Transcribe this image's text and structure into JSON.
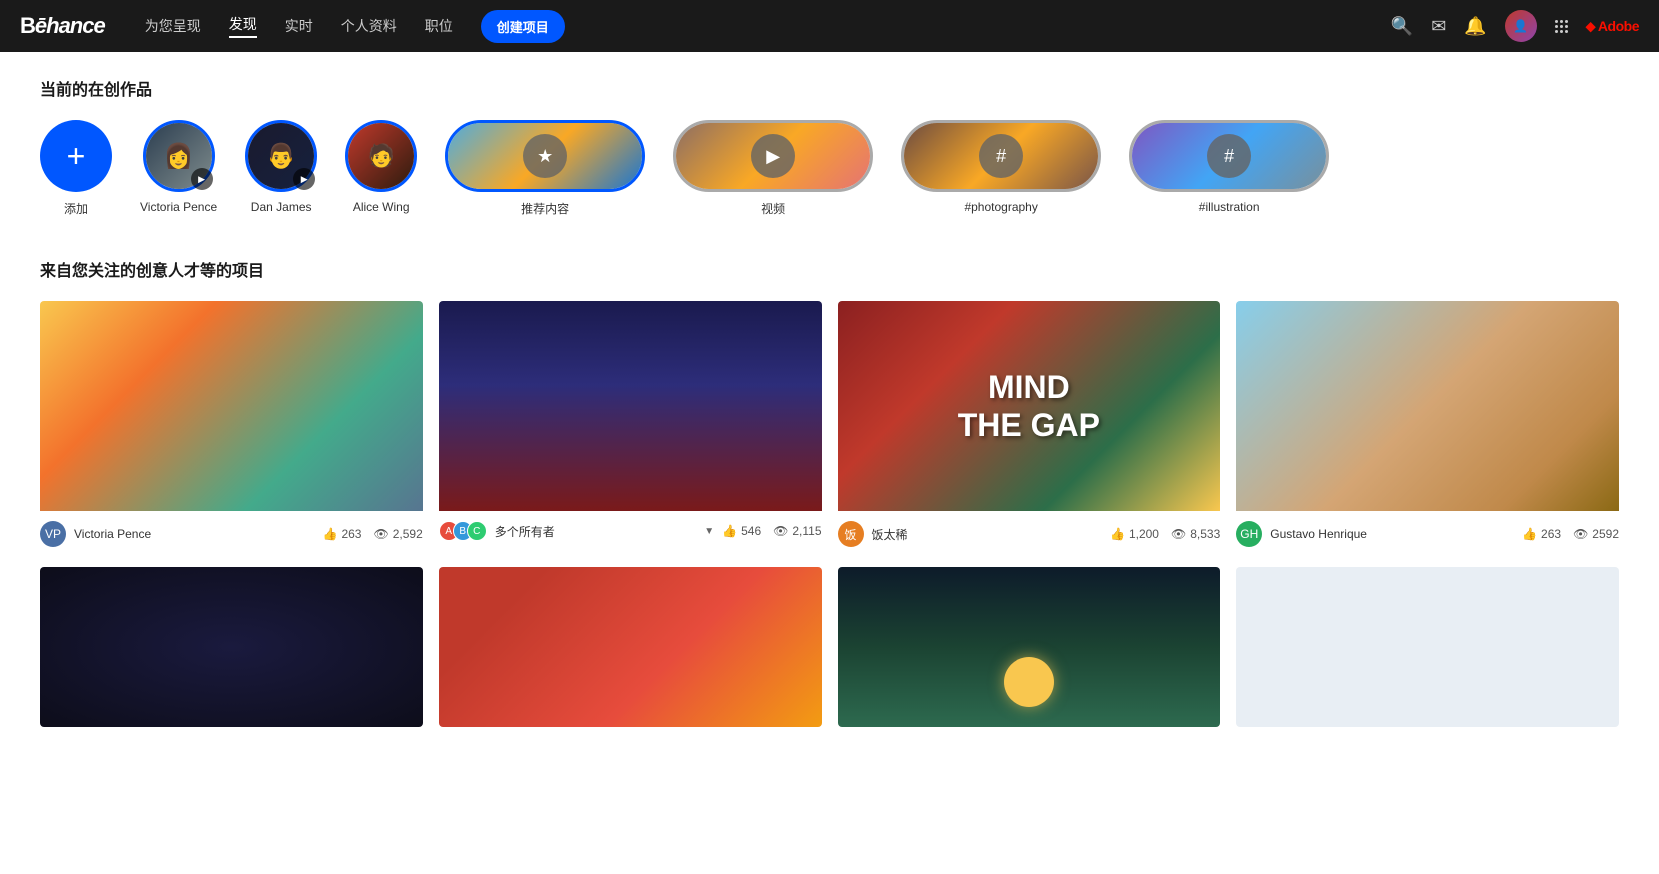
{
  "navbar": {
    "logo": "Bēhance",
    "links": [
      {
        "label": "为您呈现",
        "active": false
      },
      {
        "label": "发现",
        "active": true
      },
      {
        "label": "实时",
        "active": false
      },
      {
        "label": "个人资料",
        "active": false
      },
      {
        "label": "职位",
        "active": false
      }
    ],
    "create_btn": "创建项目",
    "icons": {
      "search": "🔍",
      "mail": "✉",
      "bell": "🔔"
    }
  },
  "stories": {
    "section_title": "当前的在创作品",
    "items": [
      {
        "id": "add",
        "label": "添加",
        "type": "add"
      },
      {
        "id": "victoria",
        "label": "Victoria Pence",
        "type": "avatar"
      },
      {
        "id": "dan",
        "label": "Dan James",
        "type": "avatar"
      },
      {
        "id": "alice",
        "label": "Alice Wing",
        "type": "avatar"
      },
      {
        "id": "recommended",
        "label": "推荐内容",
        "type": "collage"
      },
      {
        "id": "video",
        "label": "视频",
        "type": "collage-video"
      },
      {
        "id": "photography",
        "label": "#photography",
        "type": "collage-tag"
      },
      {
        "id": "illustration",
        "label": "#illustration",
        "type": "collage-tag2"
      }
    ]
  },
  "projects": {
    "section_title": "来自您关注的创意人才等的项目",
    "grid": [
      {
        "id": 1,
        "author": "Victoria Pence",
        "author_color": "#4a6fa5",
        "likes": "263",
        "views": "2,592",
        "thumb_type": "thumb-1"
      },
      {
        "id": 2,
        "author": "多个所有者",
        "multi": true,
        "likes": "546",
        "views": "2,115",
        "thumb_type": "thumb-2"
      },
      {
        "id": 3,
        "author": "饭太稀",
        "author_color": "#e67e22",
        "likes": "1,200",
        "views": "8,533",
        "thumb_type": "thumb-3"
      },
      {
        "id": 4,
        "author": "Gustavo Henrique",
        "author_color": "#27ae60",
        "likes": "263",
        "views": "2592",
        "thumb_type": "thumb-4"
      }
    ],
    "row2": [
      {
        "id": 5,
        "thumb_type": "thumb-5"
      },
      {
        "id": 6,
        "thumb_type": "thumb-6"
      },
      {
        "id": 7,
        "thumb_type": "thumb-7"
      },
      {
        "id": 8,
        "thumb_type": "thumb-8"
      }
    ]
  }
}
